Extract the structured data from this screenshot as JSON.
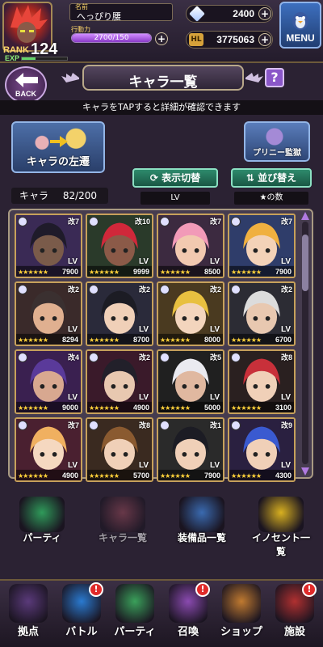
{
  "status": {
    "rank_label": "RANK",
    "rank_value": "124",
    "exp_label": "EXP",
    "name_label": "名前",
    "player_name": "へっぴり腰",
    "stamina_label": "行動力",
    "stamina": "2700/150",
    "gems": "2400",
    "hl_icon": "HL",
    "hl": "3775063",
    "menu_label": "MENU"
  },
  "header": {
    "back_label": "BACK",
    "title": "キャラ一覧",
    "help": "?",
    "notice": "キャラをTAPすると詳細が確認できます"
  },
  "actions": {
    "transfer_label": "キャラの左遷",
    "prison_label": "プリニー監獄",
    "toggle_label": "表示切替",
    "toggle_sub": "LV",
    "sort_label": "並び替え",
    "sort_sub": "★の数",
    "chara_label": "キャラ",
    "chara_count": "82/200"
  },
  "cards": [
    {
      "kai": "改7",
      "lv": "LV",
      "stars": "★★★★★★",
      "value": "7900",
      "hair": "#1f1b2a",
      "skin": "#7a5b4a",
      "bg": "#3a2a55"
    },
    {
      "kai": "改10",
      "lv": "LV",
      "stars": "★★★★★★",
      "value": "9999",
      "hair": "#d0283a",
      "skin": "#8b5a48",
      "bg": "#2a3a2a"
    },
    {
      "kai": "改7",
      "lv": "LV",
      "stars": "★★★★★★",
      "value": "8500",
      "hair": "#f29ab8",
      "skin": "#f2c9b0",
      "bg": "#3c2a40"
    },
    {
      "kai": "改7",
      "lv": "LV",
      "stars": "★★★★★★",
      "value": "7900",
      "hair": "#f0b040",
      "skin": "#f3d2b8",
      "bg": "#2f3d6a"
    },
    {
      "kai": "改2",
      "lv": "LV",
      "stars": "★★★★★★",
      "value": "8294",
      "hair": "#3a3030",
      "skin": "#e0b090",
      "bg": "#3a2a2a"
    },
    {
      "kai": "改2",
      "lv": "LV",
      "stars": "★★★★★★",
      "value": "8700",
      "hair": "#1c1c24",
      "skin": "#f0d0b8",
      "bg": "#2a2a3a"
    },
    {
      "kai": "改2",
      "lv": "LV",
      "stars": "★★★★★★",
      "value": "8000",
      "hair": "#e8c040",
      "skin": "#f3d5bd",
      "bg": "#4a3a20"
    },
    {
      "kai": "改2",
      "lv": "LV",
      "stars": "★★★★★★",
      "value": "6700",
      "hair": "#dcdcdc",
      "skin": "#e8c8b0",
      "bg": "#2c2c34"
    },
    {
      "kai": "改4",
      "lv": "LV",
      "stars": "★★★★★★",
      "value": "9000",
      "hair": "#5a3a9a",
      "skin": "#d8a890",
      "bg": "#3a2050"
    },
    {
      "kai": "改2",
      "lv": "LV",
      "stars": "★★★★★★",
      "value": "4900",
      "hair": "#22202a",
      "skin": "#e8c8b0",
      "bg": "#3a1a2a"
    },
    {
      "kai": "改5",
      "lv": "LV",
      "stars": "★★★★★★",
      "value": "5000",
      "hair": "#eaeaf0",
      "skin": "#e0b8a0",
      "bg": "#202020"
    },
    {
      "kai": "改8",
      "lv": "LV",
      "stars": "★★★★★★",
      "value": "3100",
      "hair": "#c8303a",
      "skin": "#f0d0b8",
      "bg": "#2a2020"
    },
    {
      "kai": "改7",
      "lv": "LV",
      "stars": "★★★★★★",
      "value": "4900",
      "hair": "#f0b060",
      "skin": "#f5d8c0",
      "bg": "#4a2030"
    },
    {
      "kai": "改8",
      "lv": "LV",
      "stars": "★★★★★★",
      "value": "5700",
      "hair": "#8a5a30",
      "skin": "#f0d0b8",
      "bg": "#3a2a20"
    },
    {
      "kai": "改1",
      "lv": "LV",
      "stars": "★★★★★★",
      "value": "7900",
      "hair": "#1c1c24",
      "skin": "#f0d0b8",
      "bg": "#2a2a2a"
    },
    {
      "kai": "改9",
      "lv": "LV",
      "stars": "★★★★★★",
      "value": "4300",
      "hair": "#3a5ad0",
      "skin": "#f0d0b8",
      "bg": "#2a2040"
    }
  ],
  "action_buttons": [
    {
      "label": "パーティ",
      "color": "#2f9a5a"
    },
    {
      "label": "キャラ一覧",
      "color": "#9a4a5a"
    },
    {
      "label": "装備品一覧",
      "color": "#3a6ab0"
    },
    {
      "label": "イノセント一覧",
      "color": "#d8b020"
    }
  ],
  "nav": [
    {
      "label": "拠点",
      "color": "#5a3a7a",
      "badge": ""
    },
    {
      "label": "バトル",
      "color": "#2a7ad0",
      "badge": "!"
    },
    {
      "label": "パーティ",
      "color": "#3aa05a",
      "badge": ""
    },
    {
      "label": "召喚",
      "color": "#8a4ab0",
      "badge": "!"
    },
    {
      "label": "ショップ",
      "color": "#c07a30",
      "badge": ""
    },
    {
      "label": "施設",
      "color": "#b03030",
      "badge": "!"
    }
  ]
}
